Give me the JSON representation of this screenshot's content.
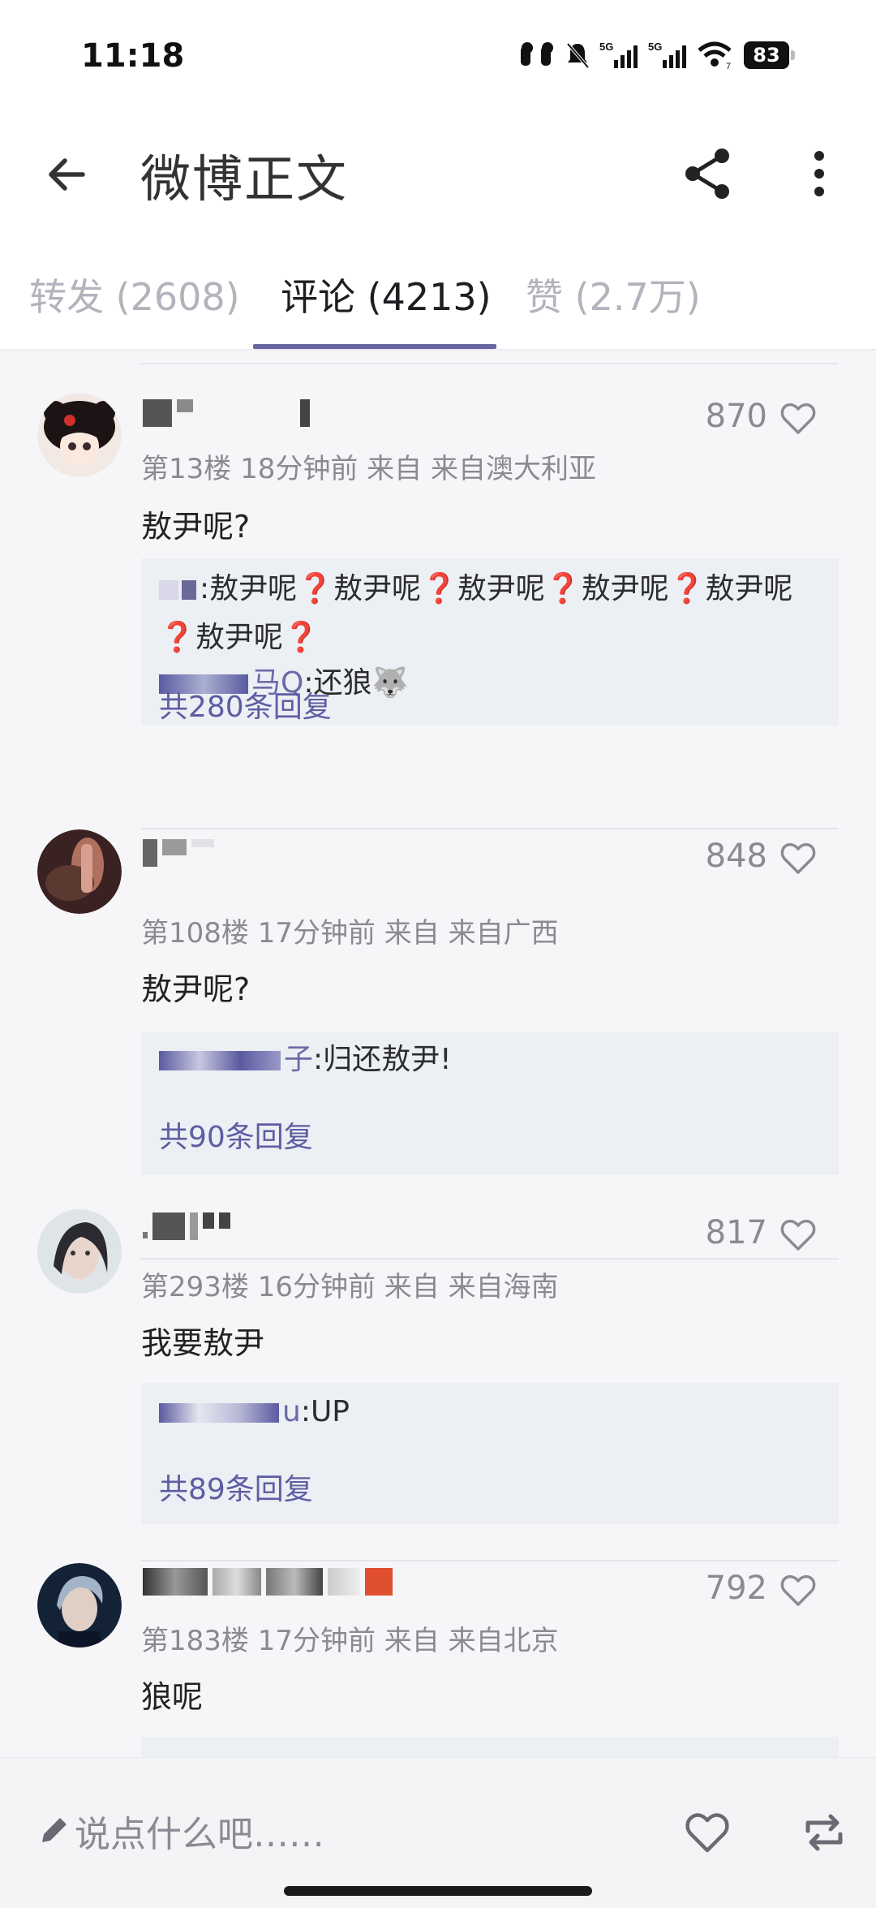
{
  "status": {
    "time": "11:18",
    "network": "5G",
    "battery": "83"
  },
  "header": {
    "title": "微博正文"
  },
  "tabs": [
    {
      "label": "转发 (2608)",
      "active": false
    },
    {
      "label": "评论 (4213)",
      "active": true
    },
    {
      "label": "赞 (2.7万)",
      "active": false
    }
  ],
  "comments": [
    {
      "floor": "第13楼",
      "time": "18分钟前",
      "source_prefix": "来自",
      "location": "来自澳大利亚",
      "likes": "870",
      "text": "敖尹呢?",
      "replies": [
        {
          "name_suffix": "",
          "text": ":敖尹呢❓敖尹呢❓敖尹呢❓敖尹呢❓敖尹呢❓敖尹呢❓"
        },
        {
          "name_suffix": "马Q",
          "text": ":还狼🐺"
        }
      ],
      "reply_count": "共280条回复"
    },
    {
      "floor": "第108楼",
      "time": "17分钟前",
      "source_prefix": "来自",
      "location": "来自广西",
      "likes": "848",
      "text": "敖尹呢?",
      "replies": [
        {
          "name_suffix": "子",
          "text": ":归还敖尹!"
        }
      ],
      "reply_count": "共90条回复"
    },
    {
      "floor": "第293楼",
      "time": "16分钟前",
      "source_prefix": "来自",
      "location": "来自海南",
      "likes": "817",
      "text": "我要敖尹",
      "replies": [
        {
          "name_suffix": "u",
          "text": ":UP"
        }
      ],
      "reply_count": "共89条回复"
    },
    {
      "floor": "第183楼",
      "time": "17分钟前",
      "source_prefix": "来自",
      "location": "来自北京",
      "likes": "792",
      "text": "狼呢",
      "replies": [],
      "reply_count": ""
    }
  ],
  "compose": {
    "placeholder": "说点什么吧……"
  },
  "colors": {
    "accent": "#6666a3",
    "link": "#5d5da3",
    "reply_bg": "#eceff3",
    "question_mark": "#e03a3a"
  },
  "icons": {
    "back": "arrow-left-icon",
    "share": "share-icon",
    "more": "more-vertical-icon",
    "like": "heart-icon",
    "compose": "pencil-icon",
    "repost": "repost-icon"
  }
}
